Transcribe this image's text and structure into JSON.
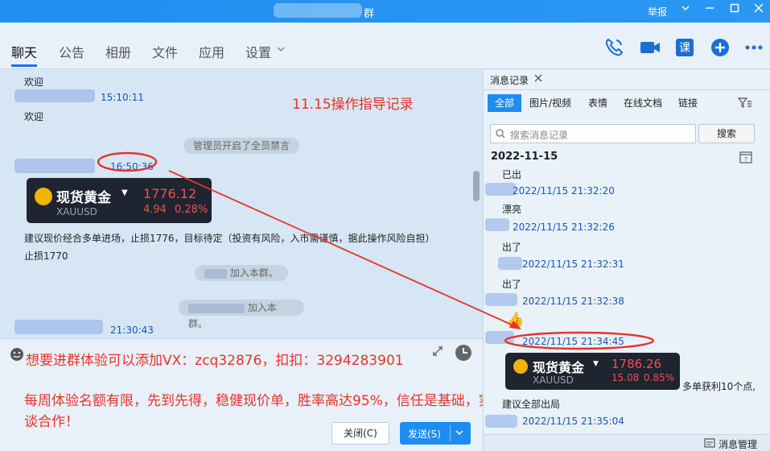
{
  "window": {
    "title": "群",
    "report": "举报",
    "controls": [
      "chevron-down-icon",
      "minimize-icon",
      "maximize-icon",
      "close-icon"
    ]
  },
  "tabs": [
    {
      "label": "聊天"
    },
    {
      "label": "公告"
    },
    {
      "label": "相册"
    },
    {
      "label": "文件"
    },
    {
      "label": "应用"
    },
    {
      "label": "设置"
    }
  ],
  "toolbar_icons": {
    "phone": "phone-icon",
    "video": "video-icon",
    "lesson": "课",
    "add": "add-icon",
    "more": "more-icon"
  },
  "chat": {
    "msg1": "欢迎",
    "time1": "15:10:11",
    "msg2": "欢迎",
    "annotation_title": "11.15操作指导记录",
    "system_mute": "管理员开启了全员禁言",
    "time2": "16:50:36",
    "card1": {
      "name": "现货黄金",
      "code": "XAUUSD",
      "price": "1776.12",
      "change": "4.94",
      "percent": "0.28%"
    },
    "advice": "建议现价经合多单进场，止损1776，目标待定（投资有风险，入市需谨慎，据此操作风险自担）",
    "stoploss": "止损1770",
    "join1": "加入本群。",
    "join2": "加入本群。",
    "time3": "21:30:43"
  },
  "input": {
    "promo1": "想要进群体验可以添加VX：zcq32876，扣扣：3294283901",
    "promo2": "每周体验名额有限，先到先得，稳健现价单，胜率高达95%，信任是基础，实力才是关键！张彦溱秉承先体验实力，再来谈合作！",
    "close_label": "关闭(C)",
    "send_label": "发送(S)"
  },
  "panel": {
    "header": "消息记录",
    "filters": [
      "全部",
      "图片/视频",
      "表情",
      "在线文档",
      "链接"
    ],
    "search_placeholder": "搜索消息记录",
    "search_button": "搜索",
    "date": "2022-11-15",
    "records": [
      {
        "text": "已出",
        "time": "2022/11/15 21:32:20"
      },
      {
        "text": "漂亮",
        "time": "2022/11/15 21:32:26"
      },
      {
        "text": "出了",
        "time": "2022/11/15 21:32:31"
      },
      {
        "text": "出了",
        "time": "2022/11/15 21:32:38"
      },
      {
        "text": "",
        "time": "2022/11/15 21:34:45"
      }
    ],
    "card2": {
      "name": "现货黄金",
      "code": "XAUUSD",
      "price": "1786.26",
      "change": "15.08",
      "percent": "0.85%"
    },
    "note": "多单获利10个点,",
    "note2": "建议全部出局",
    "last_time": "2022/11/15 21:35:04",
    "manage": "消息管理"
  }
}
